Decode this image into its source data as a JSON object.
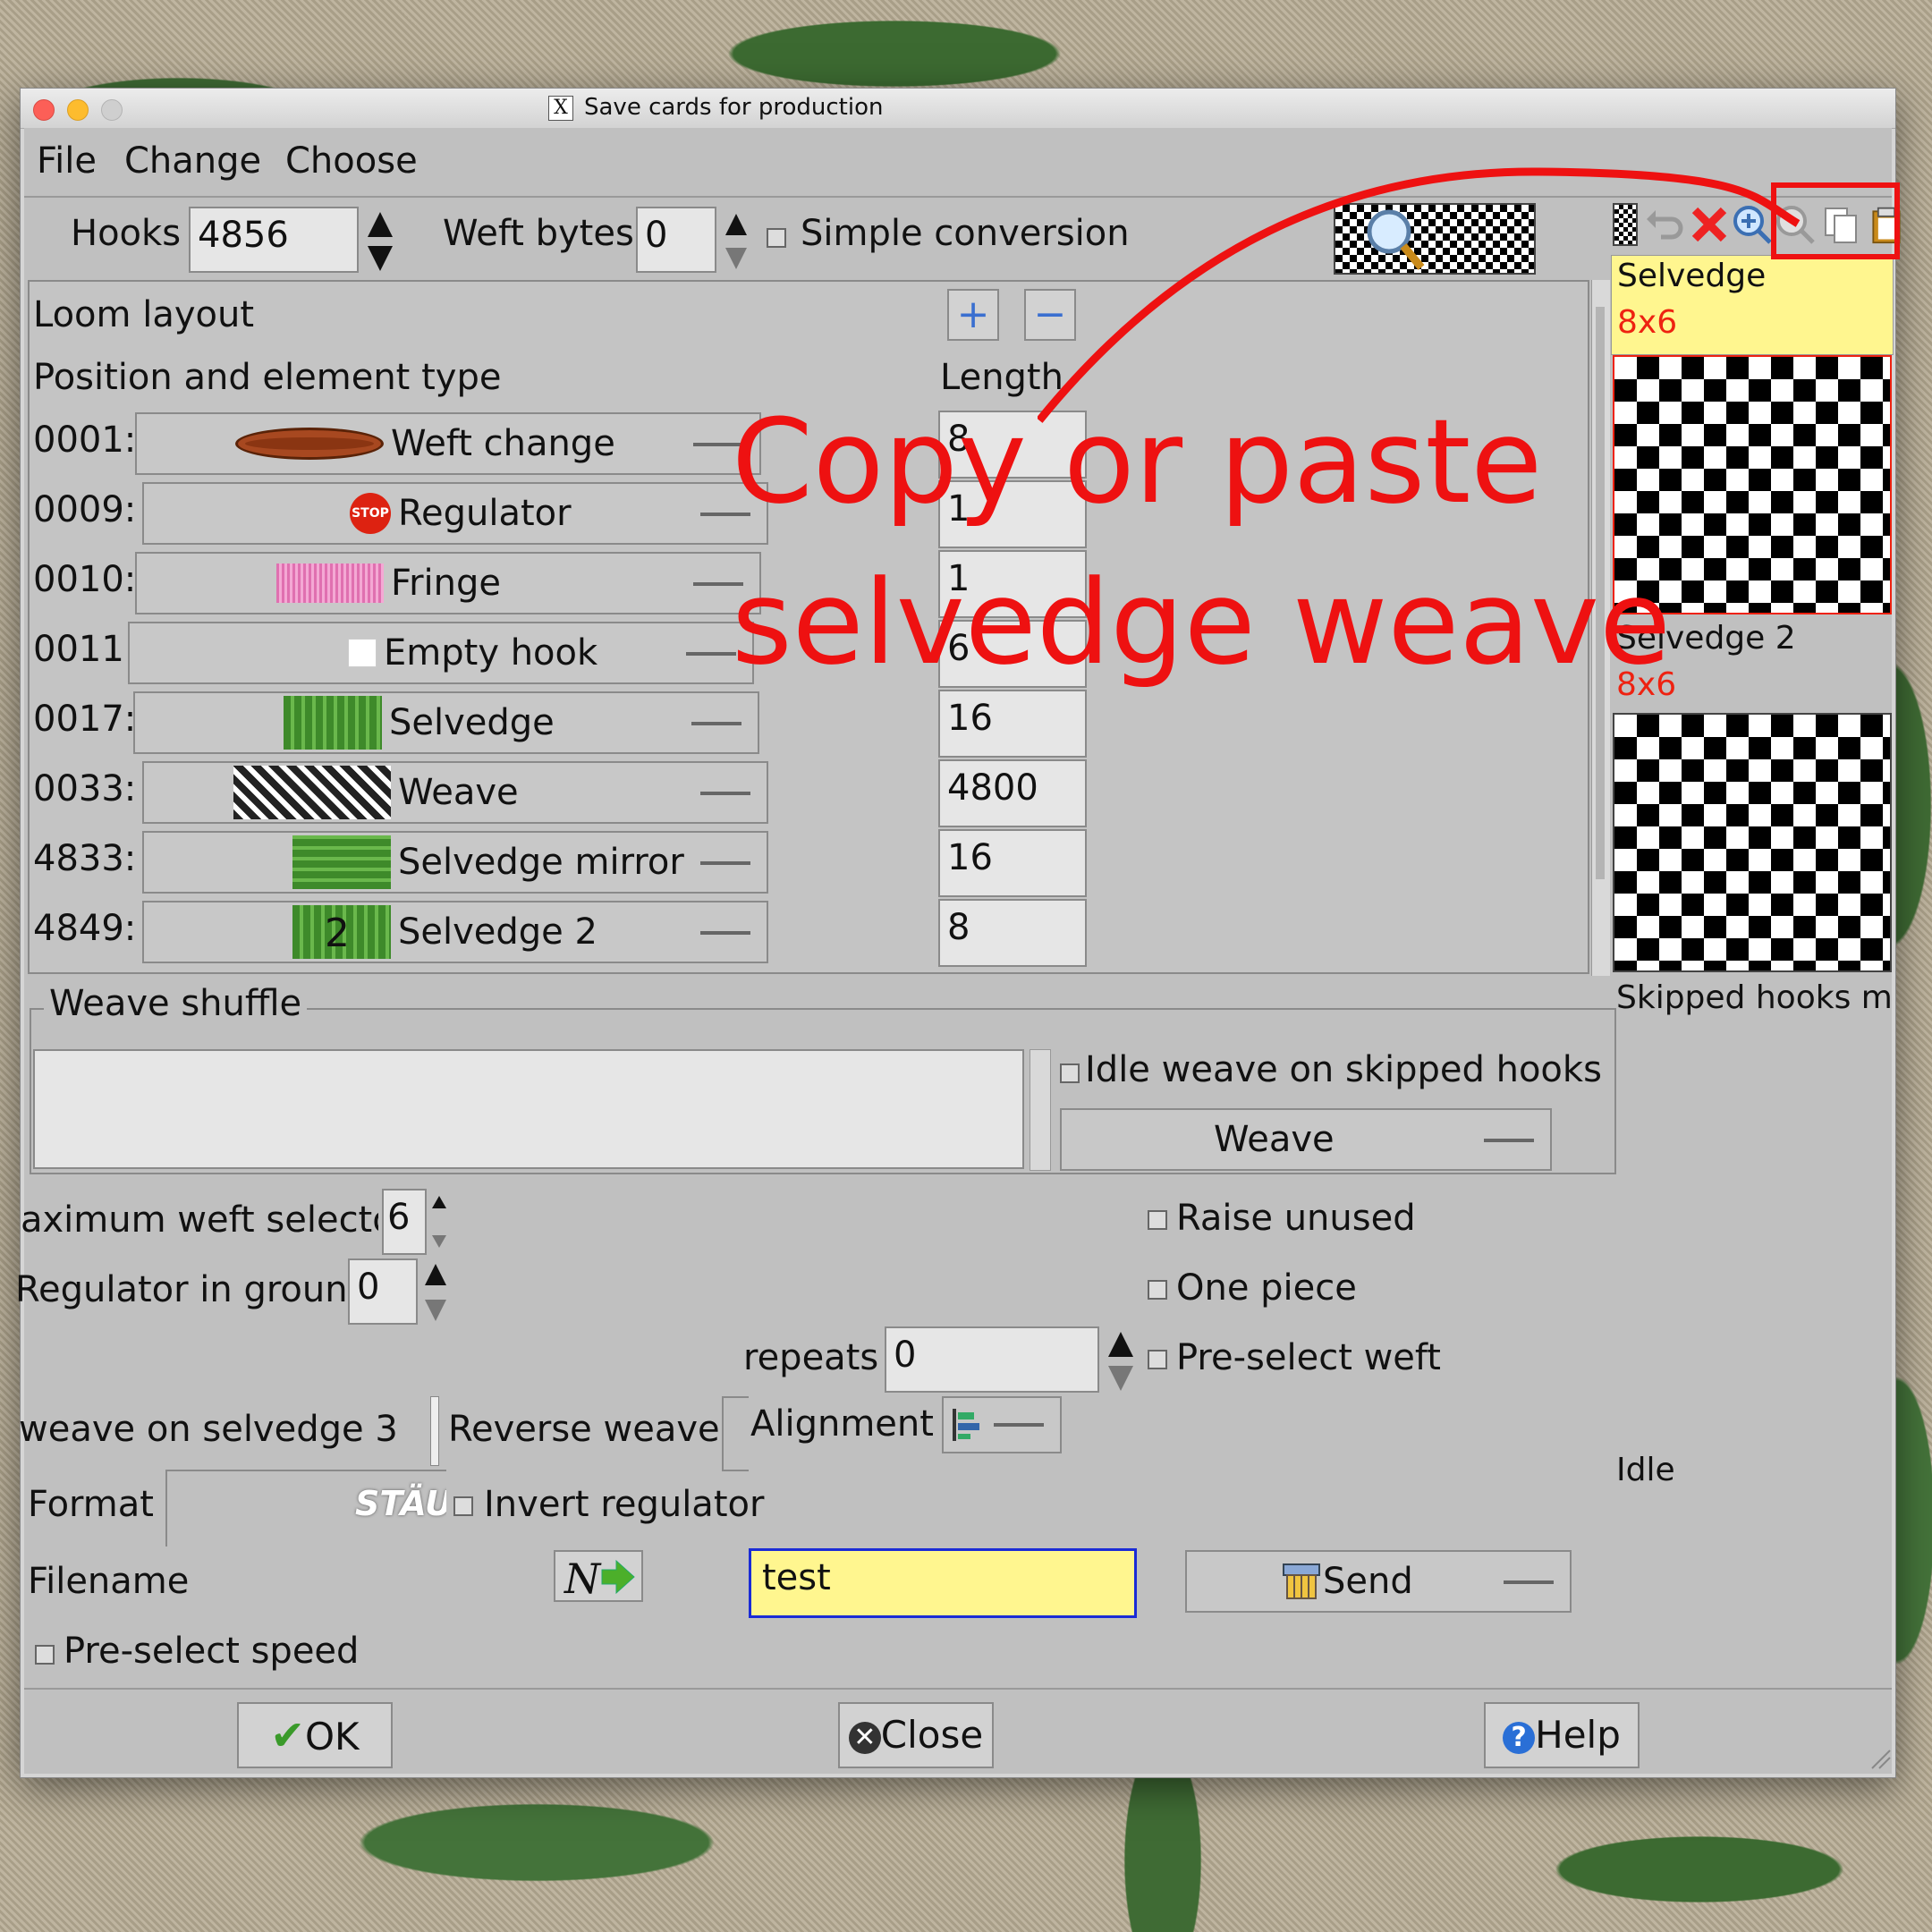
{
  "window": {
    "title": "Save cards for production"
  },
  "menu": [
    "File",
    "Change",
    "Choose"
  ],
  "top": {
    "hooks_label": "Hooks",
    "hooks_value": "4856",
    "weft_bytes_label": "Weft bytes",
    "weft_bytes_value": "0",
    "simple_conversion_label": "Simple conversion"
  },
  "loom": {
    "title": "Loom layout",
    "position_header": "Position and element type",
    "length_header": "Length",
    "rows": [
      {
        "pos": "0001:",
        "type": "Weft change",
        "length": "8",
        "icon": "shuttle-icon"
      },
      {
        "pos": "0009:",
        "type": "Regulator",
        "length": "1",
        "icon": "stop-sign-icon"
      },
      {
        "pos": "0010:",
        "type": "Fringe",
        "length": "1",
        "icon": "fringe-icon"
      },
      {
        "pos": "0011:",
        "type": "Empty hook",
        "length": "6",
        "icon": "empty-hook-icon"
      },
      {
        "pos": "0017:",
        "type": "Selvedge",
        "length": "16",
        "icon": "selvedge-icon"
      },
      {
        "pos": "0033:",
        "type": "Weave",
        "length": "4800",
        "icon": "weave-icon"
      },
      {
        "pos": "4833:",
        "type": "Selvedge mirror",
        "length": "16",
        "icon": "selvedge-mirror-icon"
      },
      {
        "pos": "4849:",
        "type": "Selvedge 2",
        "length": "8",
        "icon": "selvedge-2-icon",
        "badge": "2"
      }
    ]
  },
  "side": {
    "items": [
      {
        "name": "Selvedge",
        "size": "8x6"
      },
      {
        "name": "Selvedge 2",
        "size": "8x6"
      }
    ],
    "skipped_label": "Skipped hooks ma",
    "idle_label": "Idle"
  },
  "shuffle": {
    "title": "Weave shuffle",
    "idle_label": "Idle weave on skipped hooks",
    "idle_select": "Weave"
  },
  "options": {
    "max_weft_label": "aximum weft selecto",
    "max_weft_value": "6",
    "regulator_label": "Regulator in ground",
    "regulator_value": "0",
    "raise_unused": "Raise unused",
    "one_piece": "One piece",
    "repeats_label": "repeats",
    "repeats_value": "0",
    "preselect_weft": "Pre-select weft",
    "weave_selvedge_label": "weave on selvedge 3",
    "reverse_weave": "Reverse weave",
    "alignment_label": "Alignment",
    "format_label": "Format",
    "format_value": "STÄUI",
    "invert_regulator": "Invert regulator",
    "filename_label": "Filename",
    "filename_value": "test",
    "send_label": "Send",
    "preselect_speed": "Pre-select speed"
  },
  "buttons": {
    "ok": "OK",
    "close": "Close",
    "help": "Help"
  },
  "annotation": {
    "line1": "Copy or paste",
    "line2": "selvedge weave",
    "color": "#ee1111"
  },
  "colors": {
    "highlight_yellow": "#fff68f",
    "filename_border": "#1a2bd6"
  }
}
